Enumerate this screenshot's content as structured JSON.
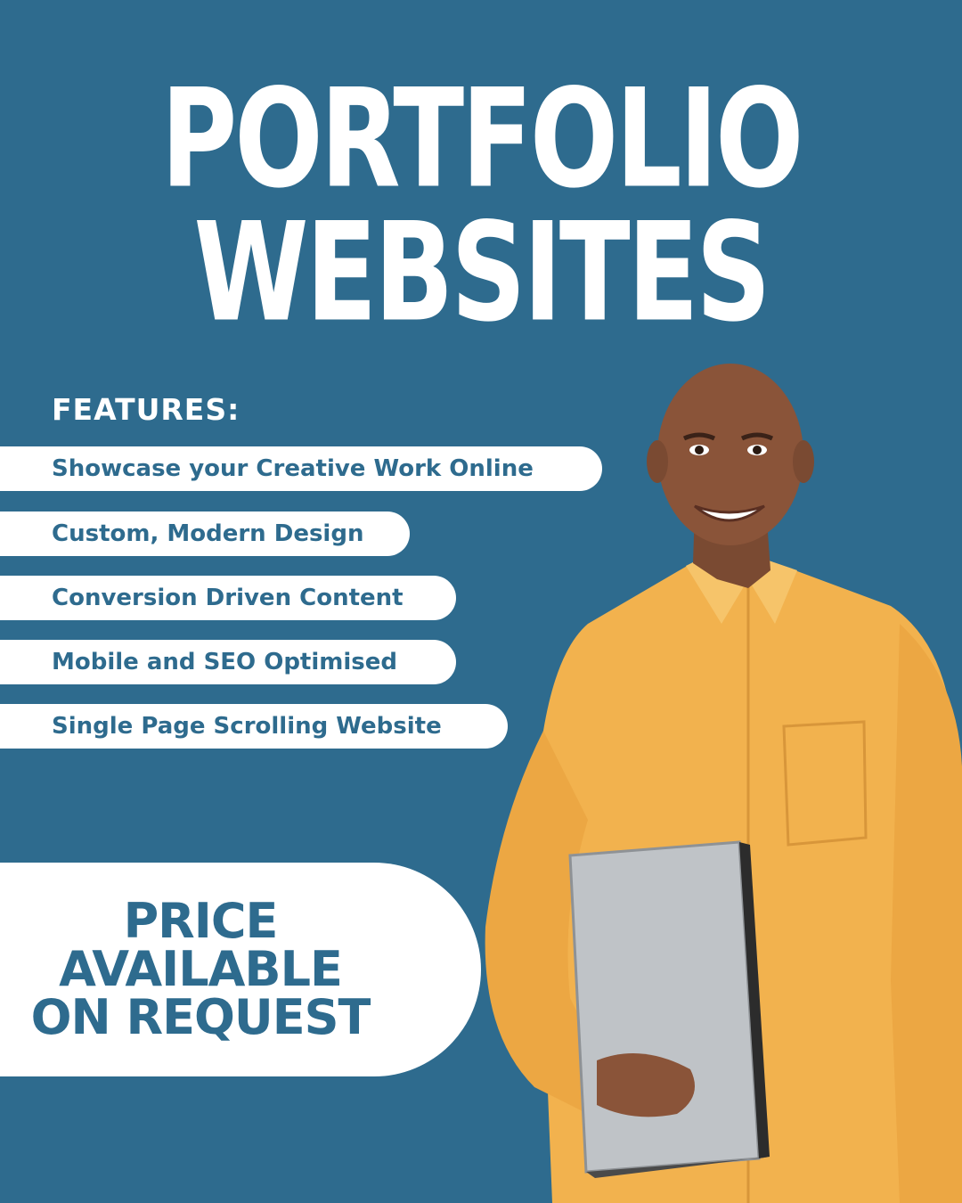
{
  "heading": {
    "line1": "PORTFOLIO",
    "line2": "WEBSITES"
  },
  "features": {
    "label": "FEATURES:",
    "items": [
      "Showcase your Creative Work Online",
      "Custom, Modern Design",
      "Conversion Driven Content",
      "Mobile and SEO Optimised",
      "Single Page Scrolling Website"
    ]
  },
  "price": {
    "line1": "PRICE",
    "line2": "AVAILABLE",
    "line3": "ON REQUEST"
  },
  "colors": {
    "background": "#2e6b8e",
    "accent_text": "#2e6b8e",
    "pill": "#ffffff",
    "shirt": "#f2b24e"
  }
}
